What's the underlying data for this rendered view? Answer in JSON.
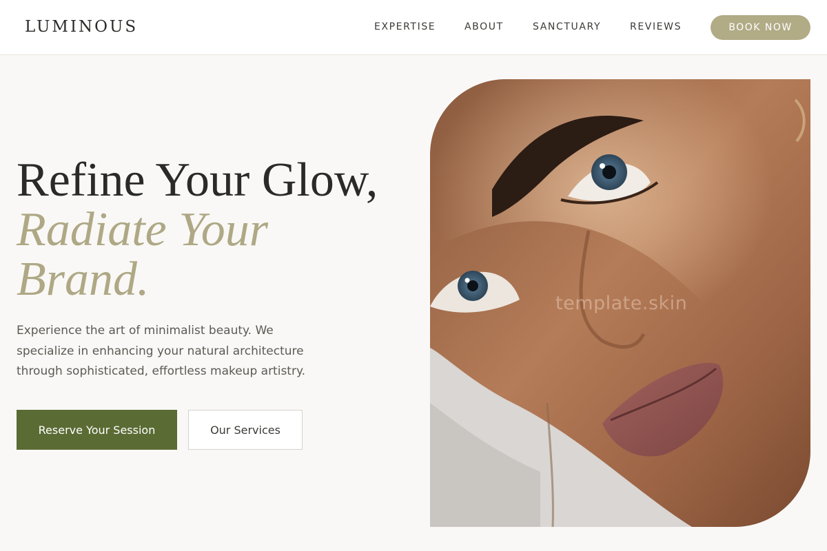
{
  "brand": {
    "name": "LUMINOUS"
  },
  "nav": {
    "items": [
      {
        "label": "EXPERTISE"
      },
      {
        "label": "ABOUT"
      },
      {
        "label": "SANCTUARY"
      },
      {
        "label": "REVIEWS"
      }
    ],
    "cta_label": "BOOK NOW"
  },
  "hero": {
    "title_line1": "Refine Your Glow,",
    "title_line2": "Radiate Your",
    "title_line3": "Brand.",
    "description": "Experience the art of minimalist beauty. We specialize in enhancing your natural architecture through sophisticated, effortless makeup artistry.",
    "primary_cta": "Reserve Your Session",
    "secondary_cta": "Our Services",
    "image_watermark": "template.skin"
  },
  "colors": {
    "accent": "#b1ab86",
    "primary_button": "#5a6b34",
    "background": "#f9f8f6"
  }
}
